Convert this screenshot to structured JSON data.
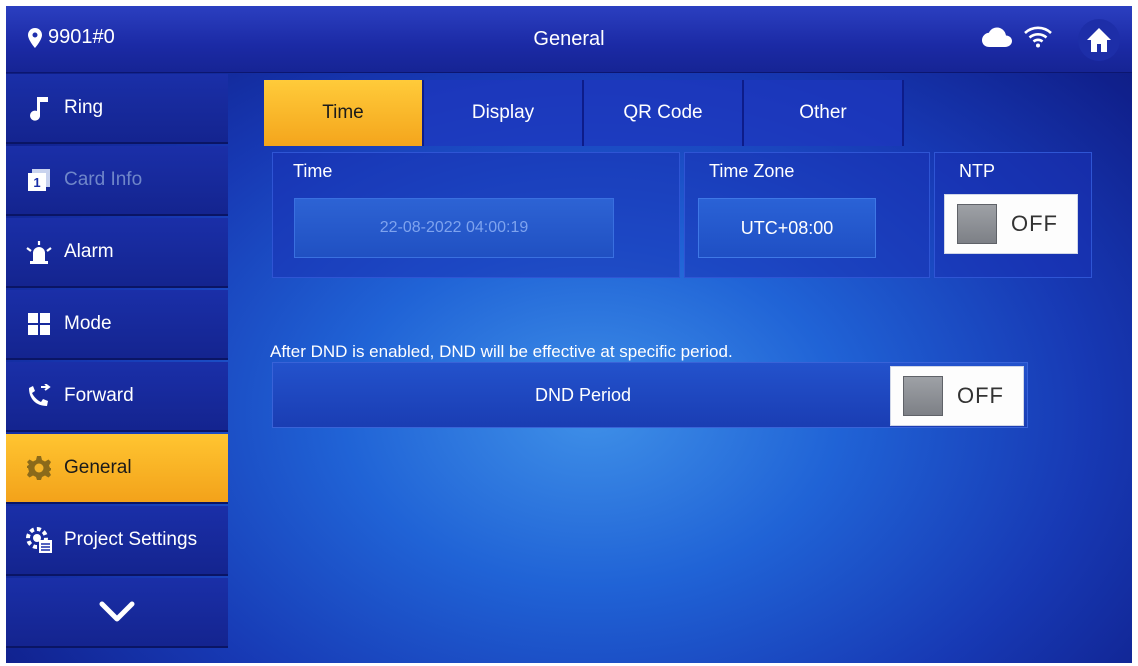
{
  "topbar": {
    "device_id": "9901#0",
    "title": "General",
    "icons": [
      "location-pin-icon",
      "cloud-icon",
      "wifi-icon",
      "home-icon"
    ]
  },
  "sidebar": {
    "items": [
      {
        "label": "Ring",
        "icon": "music-note-icon",
        "state": "normal"
      },
      {
        "label": "Card Info",
        "icon": "card-icon",
        "state": "disabled"
      },
      {
        "label": "Alarm",
        "icon": "alarm-siren-icon",
        "state": "normal"
      },
      {
        "label": "Mode",
        "icon": "mode-grid-icon",
        "state": "normal"
      },
      {
        "label": "Forward",
        "icon": "call-forward-icon",
        "state": "normal"
      },
      {
        "label": "General",
        "icon": "gear-icon",
        "state": "active"
      },
      {
        "label": "Project Settings",
        "icon": "project-settings-icon",
        "state": "normal"
      }
    ],
    "more_icon": "chevron-down-icon"
  },
  "tabs": [
    {
      "label": "Time",
      "active": true
    },
    {
      "label": "Display",
      "active": false
    },
    {
      "label": "QR Code",
      "active": false
    },
    {
      "label": "Other",
      "active": false
    }
  ],
  "time_section": {
    "time_label": "Time",
    "time_value": "22-08-2022 04:00:19",
    "timezone_label": "Time Zone",
    "timezone_value": "UTC+08:00",
    "ntp_label": "NTP",
    "ntp_state": "OFF"
  },
  "dnd": {
    "hint": "After DND is enabled, DND will be effective at specific period.",
    "period_label": "DND Period",
    "state": "OFF"
  },
  "colors": {
    "accent": "#f6ac20",
    "background": "#1d4fd0",
    "disabled_text": "#6f86c9"
  }
}
